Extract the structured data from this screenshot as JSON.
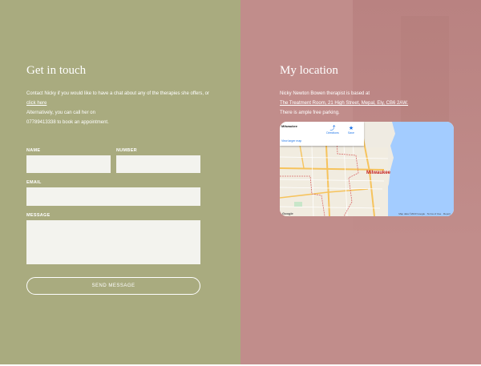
{
  "contact": {
    "title": "Get in touch",
    "intro": "Contact Nicky if you would like to have a chat about any of the therapies she offers, or",
    "link": "click here",
    "alt_line": "Alternatively, you can call her on",
    "phone": "07789413338",
    "appointment": "to book an appointment."
  },
  "form": {
    "name_label": "NAME",
    "name_placeholder": "",
    "number_label": "NUMBER",
    "email_label": "EMAIL",
    "message_label": "MESSAGE",
    "send_label": "SEND MESSAGE"
  },
  "location": {
    "title": "My location",
    "line1": "Nicky Newton Bowen therapist is based at",
    "address": "The Treatment Room, 21 High Street, Mepal, Ely, CB6 2AW.",
    "parking": "There is ample free parking."
  },
  "map": {
    "place_name": "Milwaukee",
    "place_sub": "",
    "larger_map": "View larger map",
    "directions": "Directions",
    "save": "Save",
    "city_label": "Milwaukee",
    "attribution": "Map data ©2023 Google · Terms of Use · Report",
    "logo": "Google"
  },
  "colors": {
    "left_panel": "#a9ab7f",
    "right_panel": "#c18d8b",
    "water": "#a3ccff"
  }
}
